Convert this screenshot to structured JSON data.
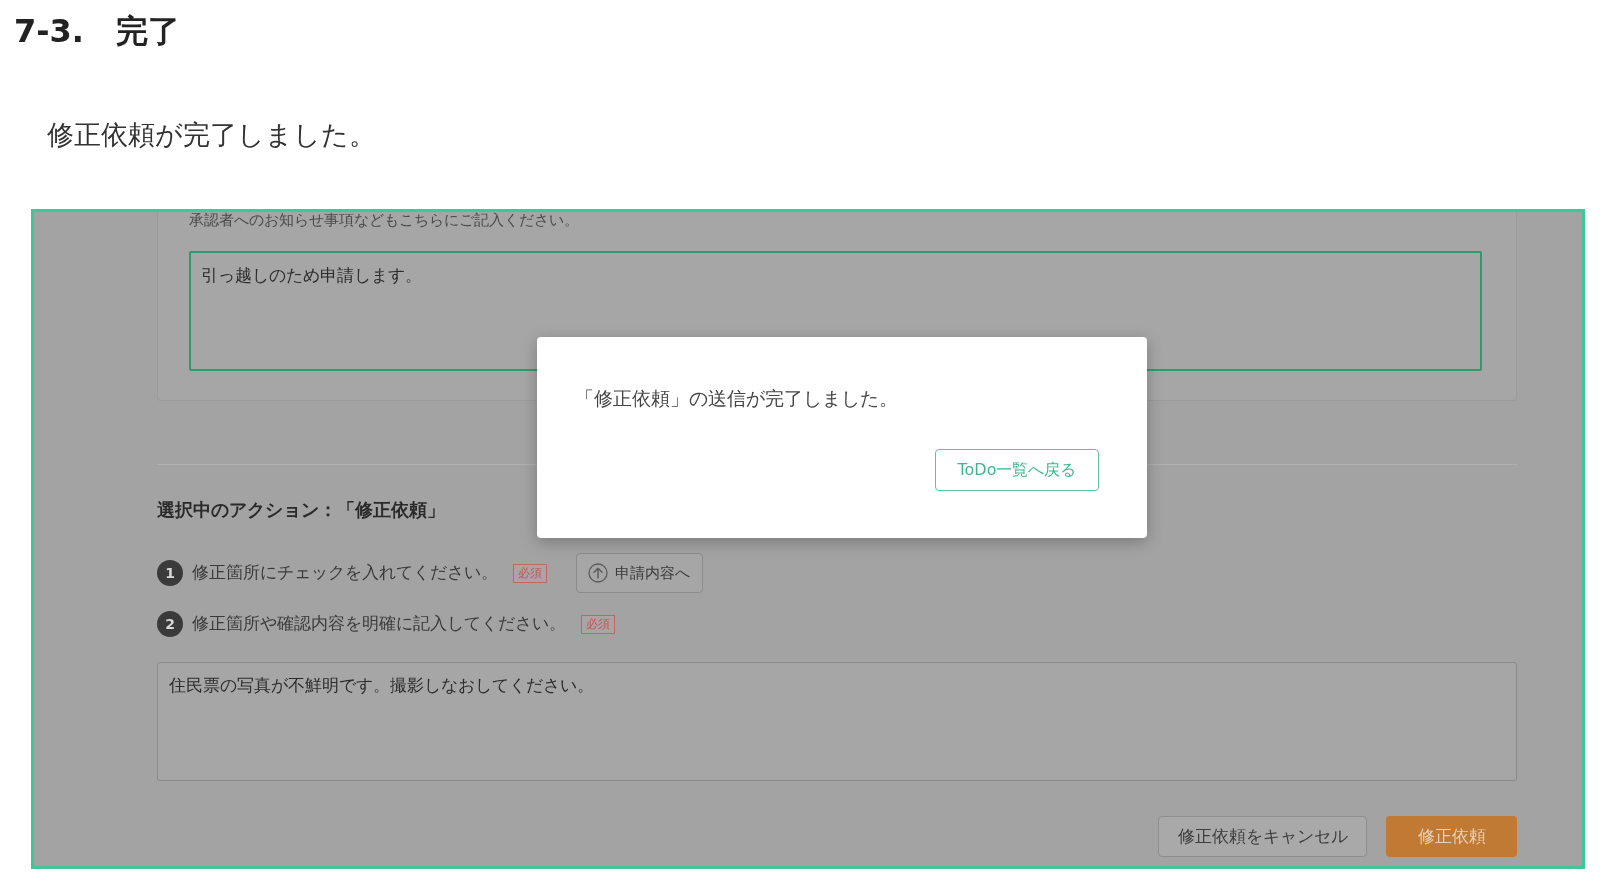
{
  "heading": "7-3.　完了",
  "intro": "修正依頼が完了しました。",
  "screenshot": {
    "message_section": {
      "hint": "承認者へのお知らせ事項などもこちらにご記入ください。",
      "value": "引っ越しのため申請します。",
      "focused": true
    },
    "action_section": {
      "title": "選択中のアクション：「修正依頼」",
      "steps": [
        {
          "number": "1",
          "text": "修正箇所にチェックを入れてください。",
          "badge": "必須",
          "button": {
            "label": "申請内容へ"
          }
        },
        {
          "number": "2",
          "text": "修正箇所や確認内容を明確に記入してください。",
          "badge": "必須"
        }
      ],
      "comment": "住民票の写真が不鮮明です。撮影しなおしてください。"
    },
    "buttons": [
      {
        "label": "修正依頼をキャンセル",
        "kind": "secondary"
      },
      {
        "label": "修正依頼",
        "kind": "primary"
      }
    ],
    "dialog": {
      "message": "「修正依頼」の送信が完了しました。",
      "button": "ToDo一覧へ戻る"
    }
  }
}
